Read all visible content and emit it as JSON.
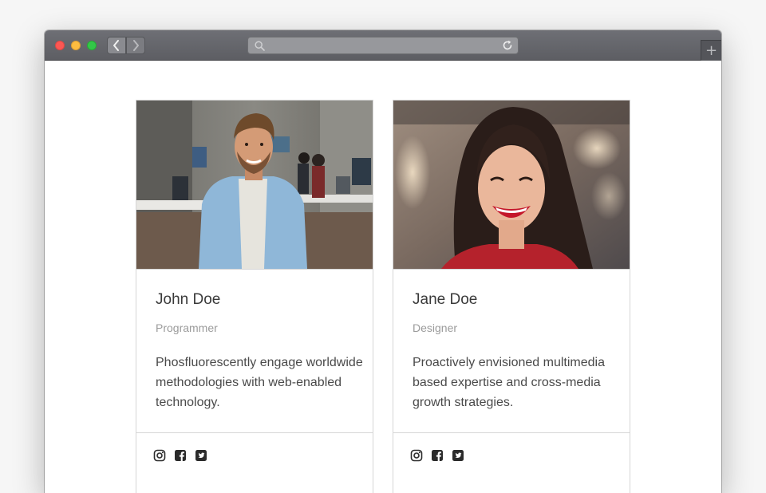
{
  "browser": {
    "url": "",
    "icons": {
      "back": "chevron-left-icon",
      "forward": "chevron-right-icon",
      "search": "magnifier-icon",
      "reload": "reload-icon",
      "new_tab": "plus-icon"
    },
    "new_tab_label": "+"
  },
  "cards": [
    {
      "name": "John Doe",
      "role": "Programmer",
      "description": "Phosfluorescently engage worldwide methodologies with web-enabled technology.",
      "photo": "man-in-office-photo",
      "social": [
        "instagram-icon",
        "facebook-icon",
        "twitter-icon"
      ]
    },
    {
      "name": "Jane Doe",
      "role": "Designer",
      "description": "Proactively envisioned multimedia based expertise and cross-media growth strategies.",
      "photo": "smiling-woman-photo",
      "social": [
        "instagram-icon",
        "facebook-icon",
        "twitter-icon"
      ]
    }
  ],
  "colors": {
    "titlebar": "#646569",
    "text_primary": "#3a3a3a",
    "text_muted": "#9b9b9b",
    "border": "#d6d6d6"
  }
}
